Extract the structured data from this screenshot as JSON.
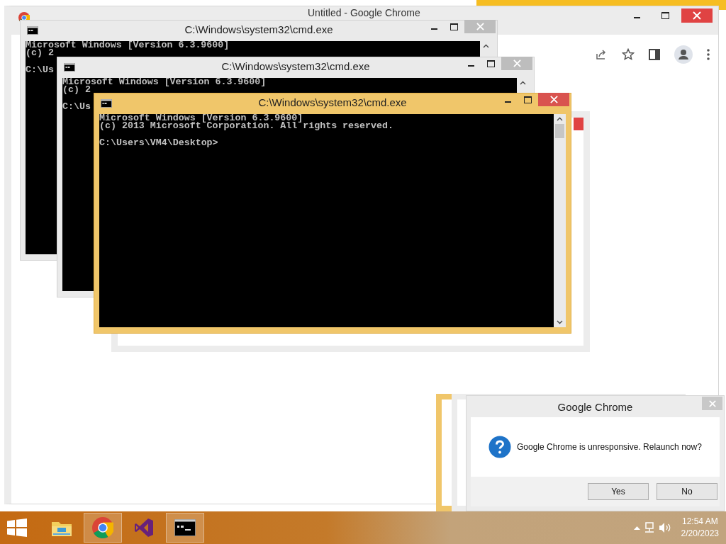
{
  "browser_window": {
    "title": "Untitled - Google Chrome"
  },
  "console_windows": [
    {
      "title": "C:\\Windows\\system32\\cmd.exe",
      "active": false,
      "banner": [
        "Microsoft Windows [Version 6.3.9600]",
        "(c) 2"
      ],
      "prompt": "C:\\Us"
    },
    {
      "title": "C:\\Windows\\system32\\cmd.exe",
      "active": false,
      "banner": [
        "Microsoft Windows [Version 6.3.9600]",
        "(c) 2"
      ],
      "prompt": "C:\\Us"
    },
    {
      "title": "C:\\Windows\\system32\\cmd.exe",
      "active": true,
      "banner": [
        "Microsoft Windows [Version 6.3.9600]",
        "(c) 2013 Microsoft Corporation. All rights reserved."
      ],
      "prompt": "C:\\Users\\VM4\\Desktop>"
    }
  ],
  "dialog": {
    "title": "Google Chrome",
    "message": "Google Chrome is unresponsive. Relaunch now?",
    "buttons": [
      "Yes",
      "No"
    ]
  },
  "taskbar": {
    "apps": [
      {
        "kind": "explorer",
        "running": false
      },
      {
        "kind": "chrome",
        "running": true
      },
      {
        "kind": "visual-studio",
        "running": false
      },
      {
        "kind": "console",
        "running": true
      }
    ],
    "time": "12:54 AM",
    "date": "2/20/2023"
  }
}
